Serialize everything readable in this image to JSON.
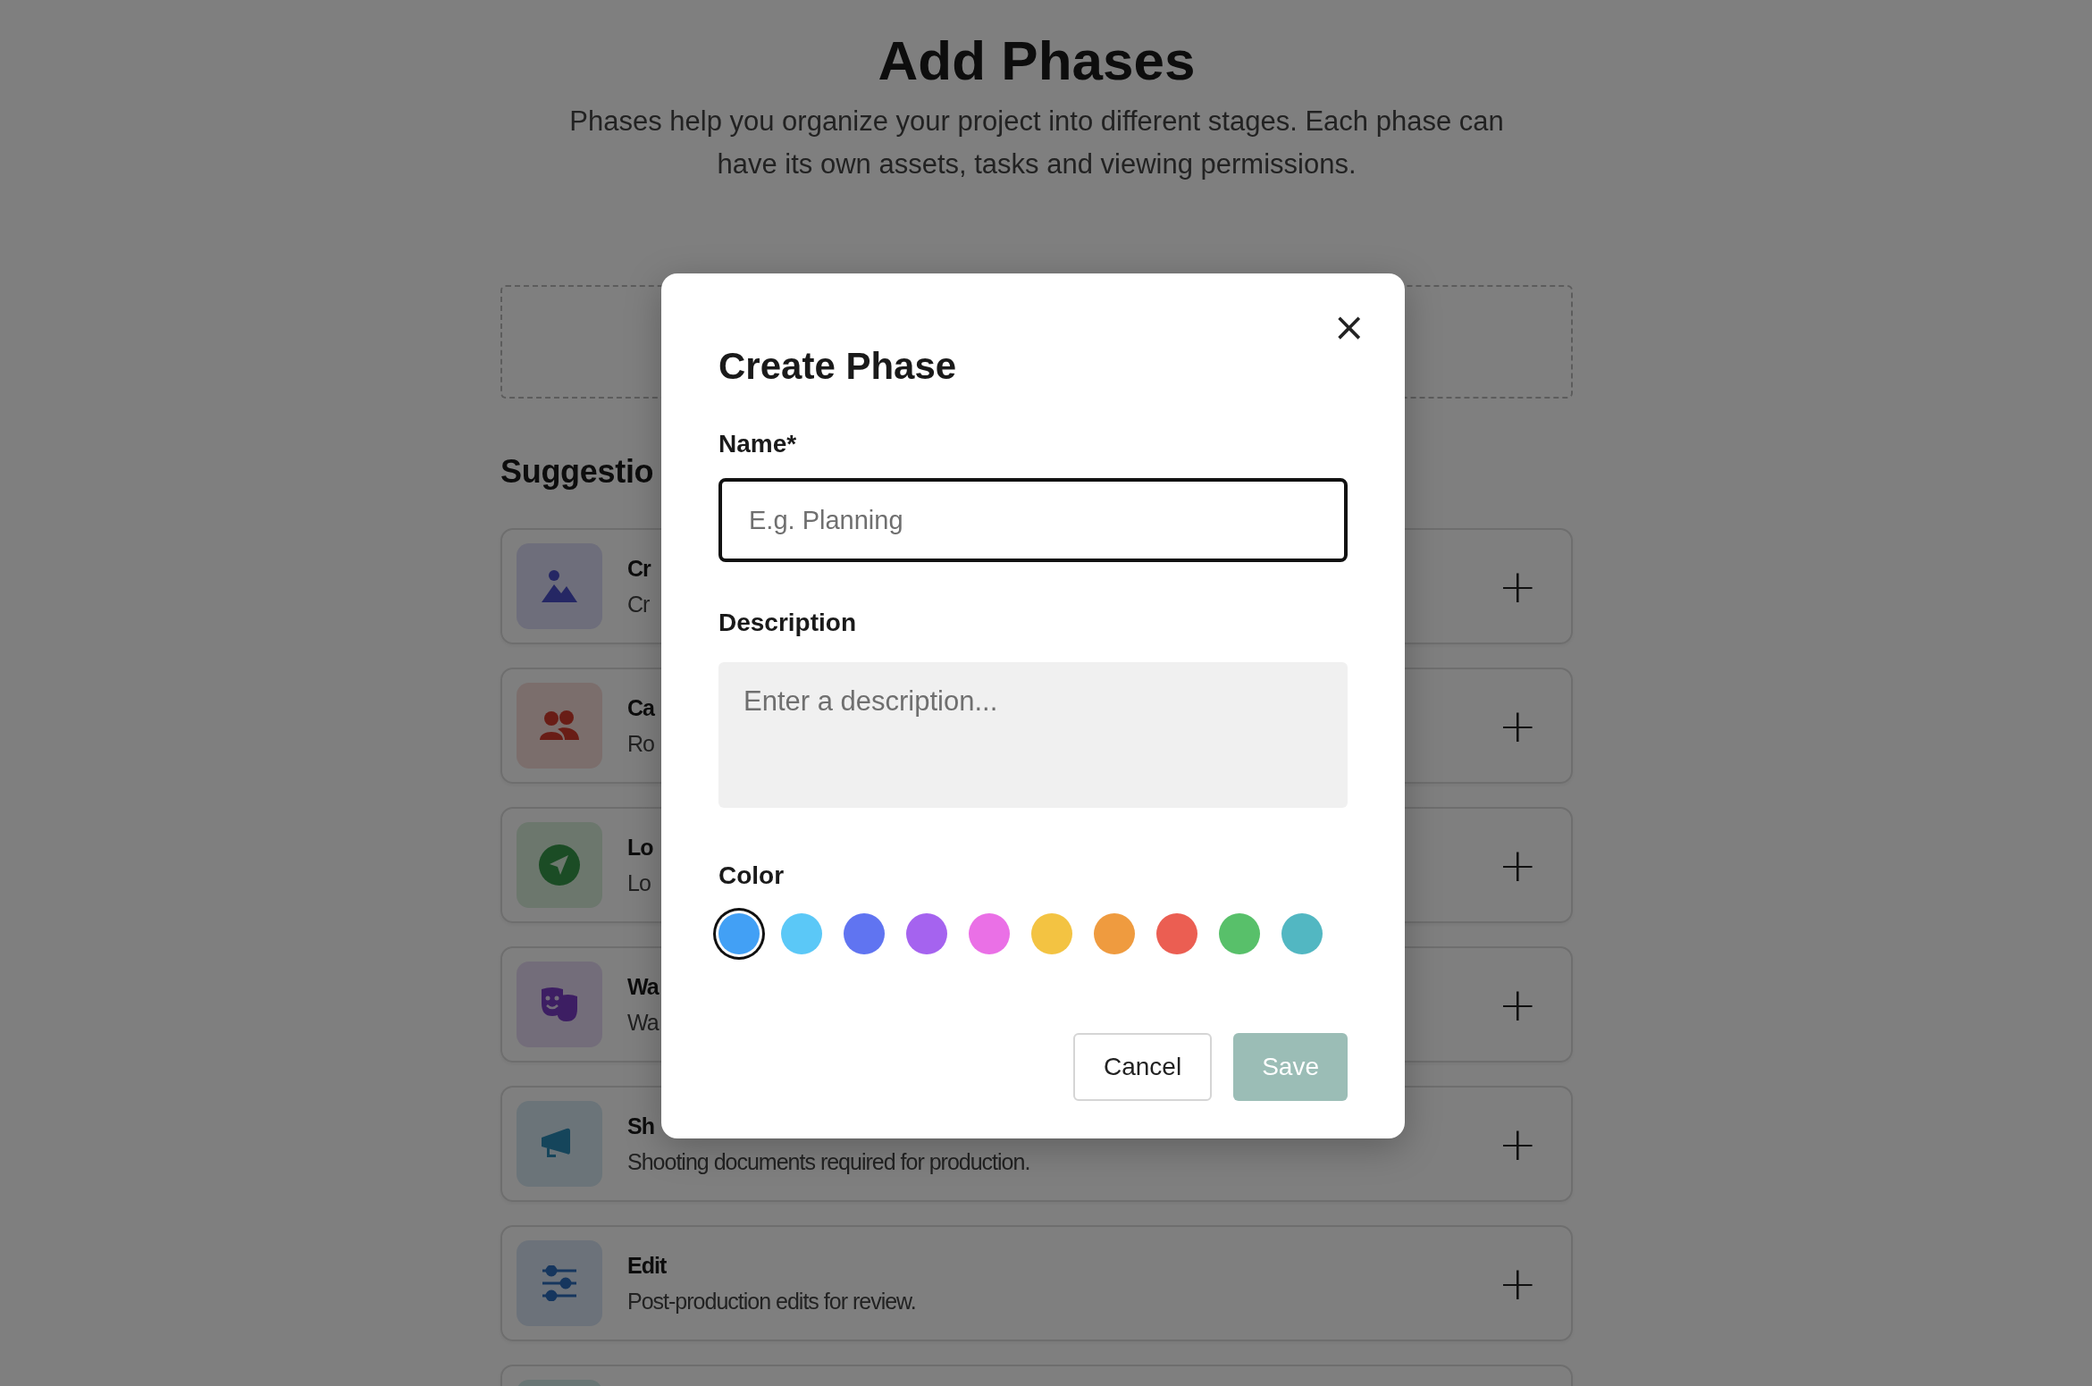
{
  "page": {
    "title": "Add Phases",
    "subtitle": "Phases help you organize your project into different stages. Each phase can have its own assets, tasks and viewing permissions."
  },
  "suggestions": {
    "heading": "Suggestio",
    "cards": [
      {
        "kind": "picture",
        "title": "Cr",
        "description": "Cr",
        "add": "+"
      },
      {
        "kind": "people",
        "title": "Ca",
        "description": "Ro",
        "add": "+"
      },
      {
        "kind": "pointer",
        "title": "Lo",
        "description": "Lo",
        "add": "+"
      },
      {
        "kind": "masks",
        "title": "Wa",
        "description": "Wa",
        "add": "+"
      },
      {
        "kind": "megaphone",
        "title": "Sh",
        "description": "Shooting documents required for production.",
        "add": "+"
      },
      {
        "kind": "sliders",
        "title": "Edit",
        "description": "Post-production edits for review.",
        "add": "+"
      },
      {
        "kind": "partial"
      }
    ]
  },
  "dialog": {
    "title": "Create Phase",
    "close": "×",
    "name": {
      "label": "Name*",
      "placeholder": "E.g. Planning",
      "focused": true
    },
    "description": {
      "label": "Description",
      "placeholder": "Enter a description..."
    },
    "color": {
      "label": "Color",
      "swatches": [
        {
          "color": "#42a0f5",
          "selected": true
        },
        {
          "color": "#5bc8f7",
          "selected": false
        },
        {
          "color": "#6074f1",
          "selected": false
        },
        {
          "color": "#a563ef",
          "selected": false
        },
        {
          "color": "#ea70e6",
          "selected": false
        },
        {
          "color": "#f3c342",
          "selected": false
        },
        {
          "color": "#ef9b3f",
          "selected": false
        },
        {
          "color": "#eb5e52",
          "selected": false
        },
        {
          "color": "#58c06a",
          "selected": false
        },
        {
          "color": "#52b7c2",
          "selected": false
        }
      ]
    },
    "buttons": [
      {
        "kind": "secondary",
        "label": "Cancel",
        "disabled": false
      },
      {
        "kind": "primary",
        "label": "Save",
        "disabled": true
      }
    ]
  }
}
